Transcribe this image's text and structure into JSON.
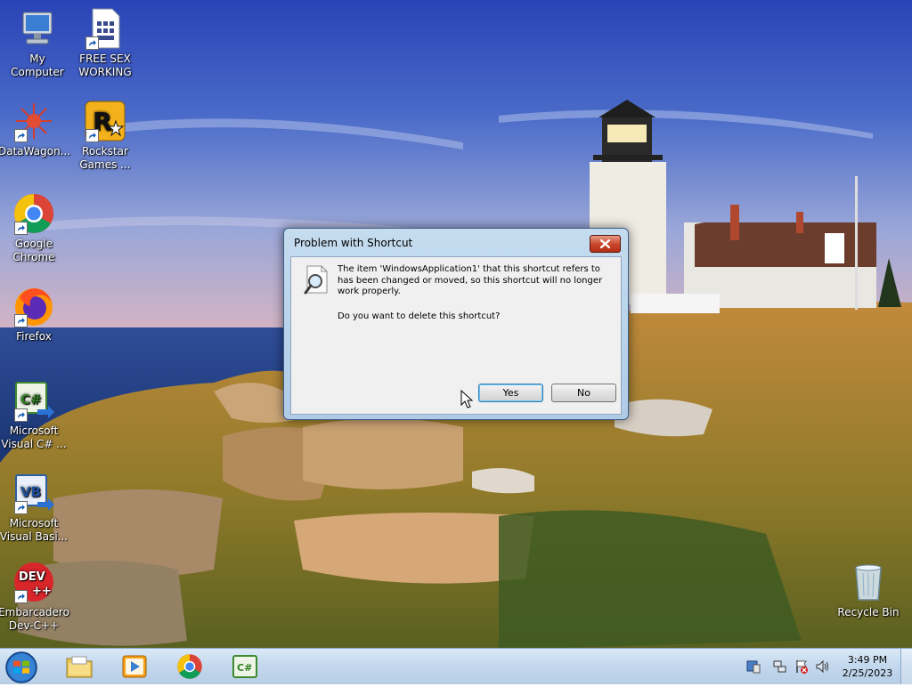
{
  "desktop": {
    "icons": [
      {
        "label": "My Computer",
        "icon": "computer-icon"
      },
      {
        "label": "FREE SEX WORKING",
        "icon": "document-icon"
      },
      {
        "label": "DataWagon...",
        "icon": "datawagon-icon"
      },
      {
        "label": "Rockstar Games ...",
        "icon": "rockstar-icon"
      },
      {
        "label": "Google Chrome",
        "icon": "chrome-icon"
      },
      {
        "label": "Firefox",
        "icon": "firefox-icon"
      },
      {
        "label": "Microsoft Visual C# ...",
        "icon": "visual-csharp-icon"
      },
      {
        "label": "Microsoft Visual Basi...",
        "icon": "visual-basic-icon"
      },
      {
        "label": "Embarcadero Dev-C++",
        "icon": "devcpp-icon"
      },
      {
        "label": "Recycle Bin",
        "icon": "recycle-bin-icon"
      }
    ],
    "glyphs": {
      "rockstar": "R",
      "csharp": "C#",
      "vb": "VB",
      "dev": "DEV",
      "devplus": "++"
    }
  },
  "dialog": {
    "title": "Problem with Shortcut",
    "message": "The item 'WindowsApplication1' that this shortcut refers to has been changed or moved, so this shortcut will no longer work properly.",
    "question": "Do you want to delete this shortcut?",
    "yes_label": "Yes",
    "no_label": "No",
    "icon": "magnifier-document-icon"
  },
  "taskbar": {
    "pinned": [
      {
        "name": "explorer-icon"
      },
      {
        "name": "media-player-icon"
      },
      {
        "name": "chrome-icon"
      },
      {
        "name": "visual-csharp-icon"
      }
    ],
    "tray_icons": [
      "action-center-icon",
      "network-icon",
      "flag-icon",
      "volume-icon"
    ],
    "time": "3:49 PM",
    "date": "2/25/2023"
  },
  "colors": {
    "dialog_frame": "#b0cbe6",
    "close_button": "#c9442a",
    "taskbar": "#c4d9ee",
    "sky": "#3a55b8"
  }
}
